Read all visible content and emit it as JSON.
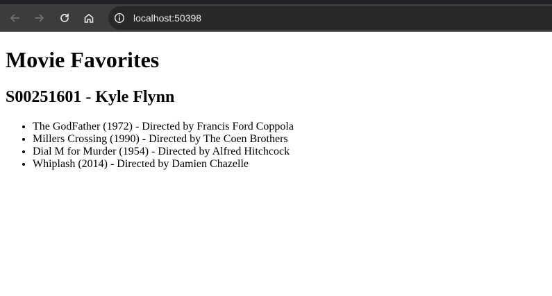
{
  "browser": {
    "url": "localhost:50398",
    "icons": [
      "back-arrow-icon",
      "forward-arrow-icon",
      "reload-icon",
      "home-icon",
      "info-icon"
    ]
  },
  "page": {
    "title": "Movie Favorites",
    "subtitle": "S00251601 - Kyle Flynn",
    "movies": [
      "The GodFather (1972) - Directed by Francis Ford Coppola",
      "Millers Crossing (1990) - Directed by The Coen Brothers",
      "Dial M for Murder (1954) - Directed by Alfred Hitchcock",
      "Whiplash (2014) - Directed by Damien Chazelle"
    ]
  },
  "colors": {
    "toolbar": "#3c3c3c",
    "omnibox": "#282828",
    "icon": "#9aa0a6",
    "icon_active": "#e8eaed",
    "page_background": "#ffffff",
    "text": "#000000"
  }
}
